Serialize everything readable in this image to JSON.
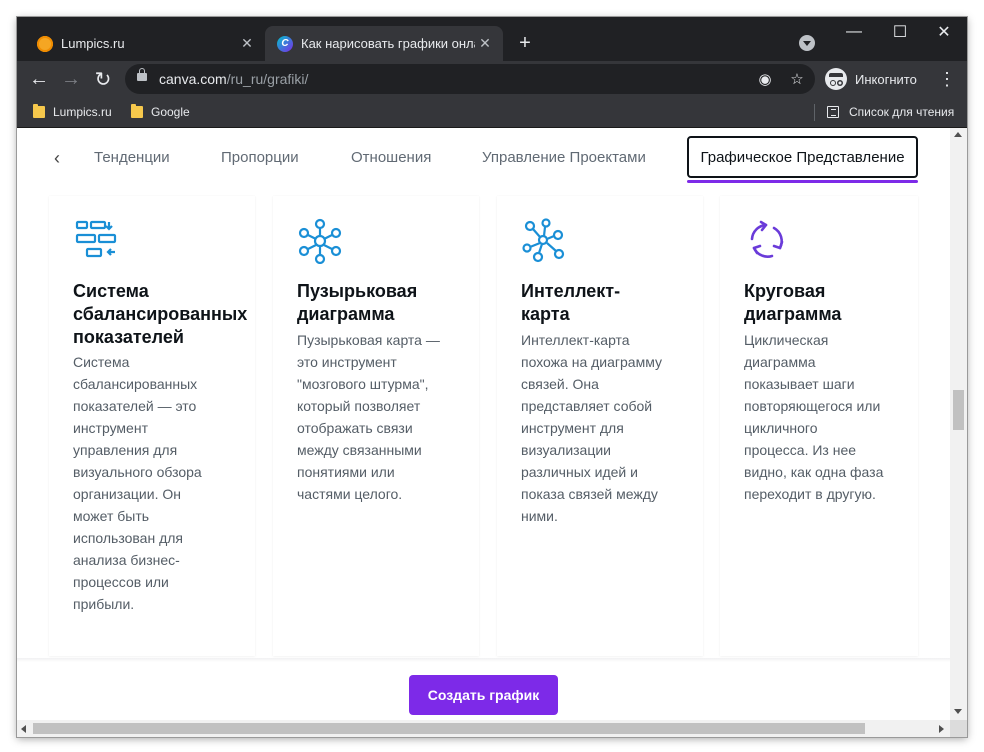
{
  "browser": {
    "tabs": [
      {
        "title": "Lumpics.ru",
        "active": false
      },
      {
        "title": "Как нарисовать графики онлай",
        "active": true
      }
    ],
    "address": {
      "domain": "canva.com",
      "path": "/ru_ru/grafiki/"
    },
    "profile_label": "Инкогнито",
    "bookmarks": [
      {
        "label": "Lumpics.ru"
      },
      {
        "label": "Google"
      }
    ],
    "reading_list_label": "Список для чтения"
  },
  "categories": {
    "items": [
      "Тенденции",
      "Пропорции",
      "Отношения",
      "Управление Проектами",
      "Графическое Представление"
    ],
    "active_index": 4
  },
  "cards": [
    {
      "icon": "balanced-scorecard-icon",
      "title": [
        "Система",
        "сбалансированных",
        "показателей"
      ],
      "description": [
        "Система",
        "сбалансированных",
        "показателей — это",
        "инструмент",
        "управления для",
        "визуального обзора",
        "организации. Он",
        "может быть",
        "использован для",
        "анализа бизнес-",
        "процессов или",
        "прибыли."
      ]
    },
    {
      "icon": "bubble-map-icon",
      "title": [
        "Пузырьковая",
        "диаграмма"
      ],
      "description": [
        "Пузырьковая карта —",
        "это инструмент",
        "\"мозгового штурма\",",
        "который позволяет",
        "отображать связи",
        "между связанными",
        "понятиями или",
        "частями целого."
      ]
    },
    {
      "icon": "mind-map-icon",
      "title": [
        "Интеллект-",
        "карта"
      ],
      "description": [
        "Интеллект-карта",
        "похожа на диаграмму",
        "связей. Она",
        "представляет собой",
        "инструмент для",
        "визуализации",
        "различных идей и",
        "показа связей между",
        "ними."
      ]
    },
    {
      "icon": "cycle-diagram-icon",
      "title": [
        "Круговая",
        "диаграмма"
      ],
      "description": [
        "Циклическая",
        "диаграмма",
        "показывает шаги",
        "повторяющегося или",
        "цикличного",
        "процесса. Из нее",
        "видно, как одна фаза",
        "переходит в другую."
      ]
    }
  ],
  "cta": {
    "label": "Создать график"
  },
  "colors": {
    "accent": "#7d2ae8",
    "icon_blue": "#1a8fd6",
    "icon_purple": "#6a3bd9",
    "chrome_dark": "#202124",
    "chrome_toolbar": "#35363a"
  }
}
